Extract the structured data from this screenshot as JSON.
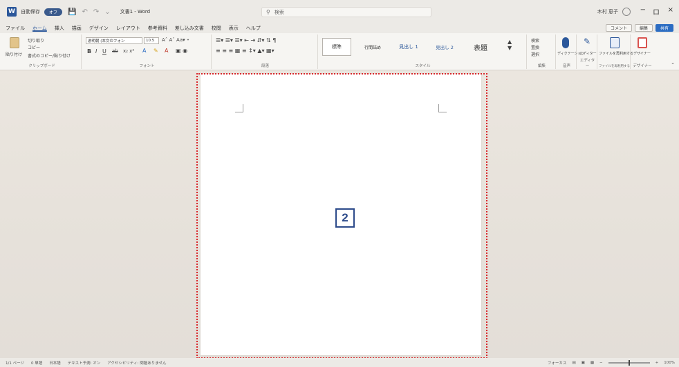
{
  "titlebar": {
    "autosave_label": "自動保存",
    "autosave_state": "オフ",
    "doc_title": "文書1 - Word",
    "search_placeholder": "検索",
    "user_name": "木村 恵子",
    "minimize": "−",
    "restore": "ロ",
    "close": "×"
  },
  "menu": {
    "tabs": [
      "ファイル",
      "ホーム",
      "挿入",
      "描画",
      "デザイン",
      "レイアウト",
      "参考資料",
      "差し込み文書",
      "校閲",
      "表示",
      "ヘルプ"
    ],
    "active_index": 1,
    "comment_button": "コメント",
    "edit_button": "編集",
    "share_button": "共有"
  },
  "ribbon": {
    "clipboard": {
      "paste": "貼り付け",
      "cut": "切り取り",
      "copy": "コピー",
      "format_painter": "書式のコピー/貼り付け",
      "label": "クリップボード"
    },
    "font": {
      "font_name": "游明朝 (本文のフォン",
      "font_size": "10.5",
      "label": "フォント"
    },
    "paragraph": {
      "label": "段落"
    },
    "styles": {
      "items": [
        "標準",
        "行間詰め",
        "見出し 1",
        "見出し 2",
        "表題"
      ],
      "selected_index": 0,
      "label": "スタイル"
    },
    "editing": {
      "find": "検索",
      "replace": "置換",
      "select": "選択",
      "label": "編集"
    },
    "voice": {
      "dictate": "ディクテーション",
      "label": "音声"
    },
    "editor": {
      "editor": "エディター",
      "label": "エディター"
    },
    "reuse": {
      "reuse_files": "ファイルを再利用する",
      "label": "ファイルを再利用する"
    },
    "designer": {
      "designer": "デザイナー",
      "label": "デザイナー"
    }
  },
  "callout": {
    "number": "2"
  },
  "statusbar": {
    "page": "1/1 ページ",
    "words": "0 単語",
    "language": "日本語",
    "text_predictions": "テキスト予測: オン",
    "accessibility": "アクセシビリティ: 問題ありません",
    "focus": "フォーカス",
    "zoom": "100%"
  },
  "colors": {
    "word_blue": "#2b579a",
    "callout_red": "#d9262b",
    "callout_blue": "#2c4a8a",
    "share_blue": "#2b6cc2"
  }
}
